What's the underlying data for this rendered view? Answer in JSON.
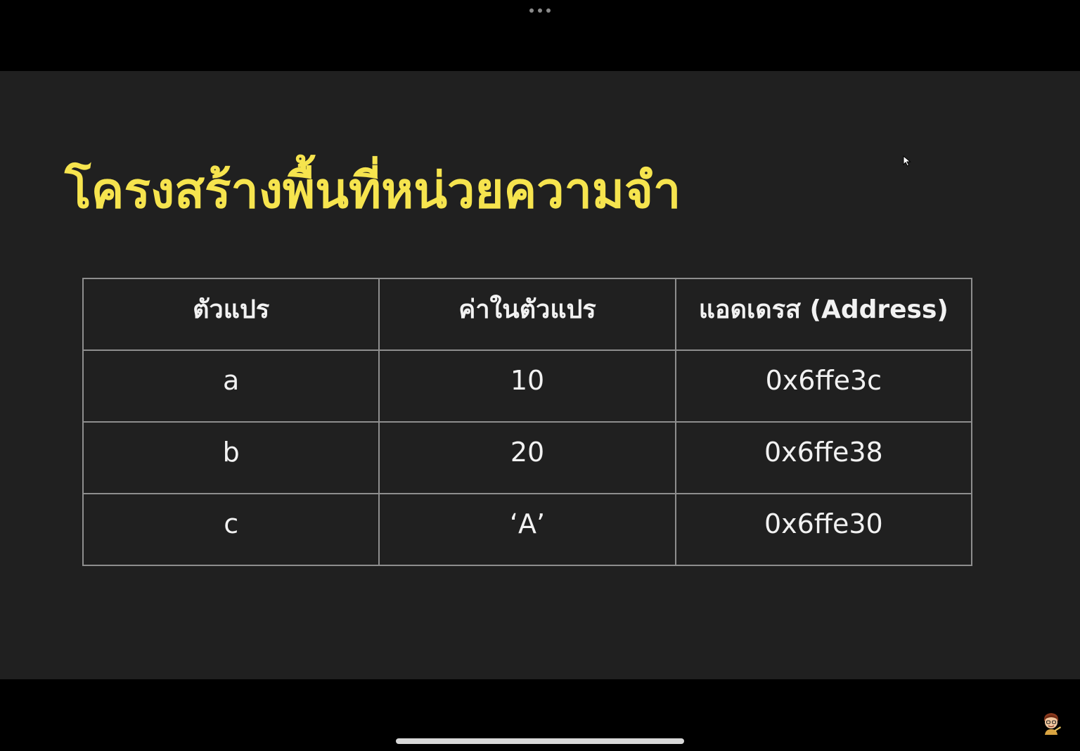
{
  "slide": {
    "title": "โครงสร้างพื้นที่หน่วยความจำ"
  },
  "table": {
    "headers": [
      "ตัวแปร",
      "ค่าในตัวแปร",
      "แอดเดรส (Address)"
    ],
    "rows": [
      [
        "a",
        "10",
        "0x6ffe3c"
      ],
      [
        "b",
        "20",
        "0x6ffe38"
      ],
      [
        "c",
        "‘A’",
        "0x6ffe30"
      ]
    ]
  },
  "colors": {
    "title": "#f6e44e",
    "slide_background": "#202020",
    "grid_lines": "#8e8e8e",
    "text": "#f2f2f2",
    "letterbox": "#000000"
  },
  "icons": {
    "top_control": "more-dots-icon",
    "pointer": "mouse-cursor-icon",
    "corner": "cartoon-avatar-icon"
  }
}
